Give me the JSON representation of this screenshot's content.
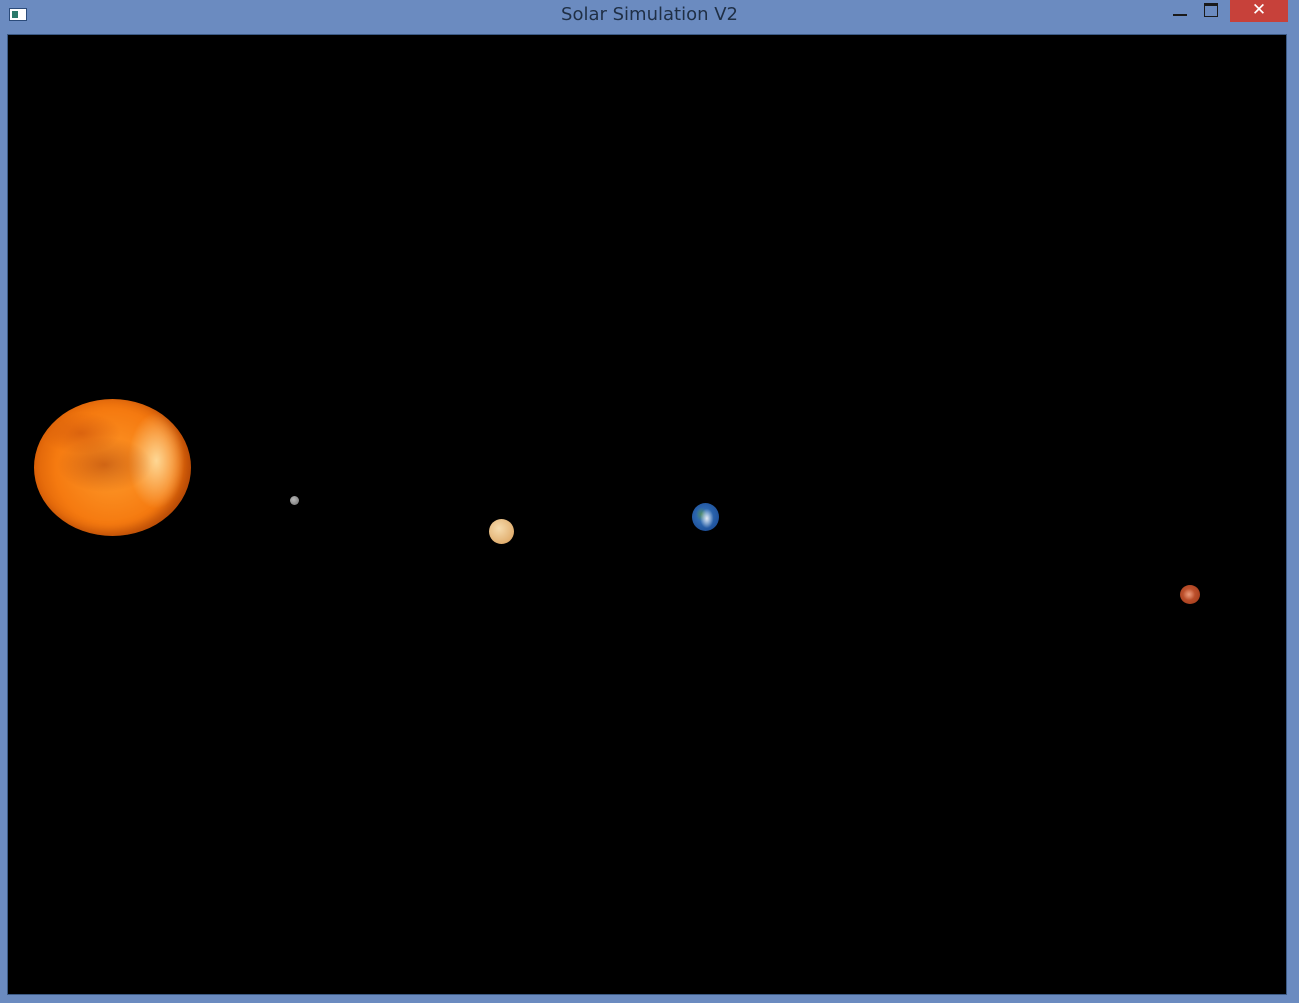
{
  "window": {
    "title": "Solar Simulation V2",
    "frame_color": "#6b8bc0",
    "close_color": "#c7413a",
    "controls": {
      "minimize_icon": "minimize-icon",
      "maximize_icon": "maximize-icon",
      "close_icon": "close-icon",
      "close_glyph": "✕"
    }
  },
  "scene": {
    "background": "#000000",
    "bodies": [
      {
        "name": "sun",
        "color": "#f57a10"
      },
      {
        "name": "mercury",
        "color": "#8a8a8a"
      },
      {
        "name": "venus",
        "color": "#e2b071"
      },
      {
        "name": "earth",
        "color": "#1d4f99"
      },
      {
        "name": "mars",
        "color": "#a8401e"
      }
    ]
  }
}
